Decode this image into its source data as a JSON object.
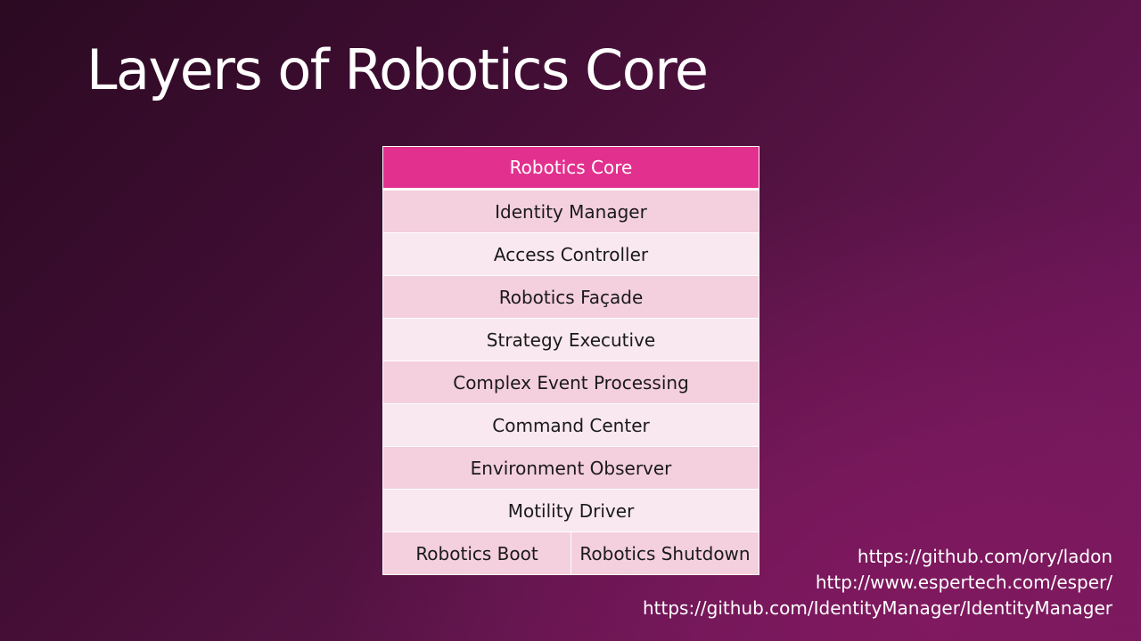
{
  "slide": {
    "title": "Layers of Robotics Core"
  },
  "table": {
    "header": "Robotics Core",
    "layers": [
      "Identity Manager",
      "Access Controller",
      "Robotics Façade",
      "Strategy Executive",
      "Complex Event Processing",
      "Command Center",
      "Environment Observer",
      "Motility Driver"
    ],
    "bottom_row": [
      "Robotics Boot",
      "Robotics Shutdown"
    ]
  },
  "links": [
    "https://github.com/ory/ladon",
    "http://www.espertech.com/esper/",
    "https://github.com/IdentityManager/IdentityManager"
  ],
  "colors": {
    "header_fill": "#e2308e",
    "row_dark": "#f4cfdd",
    "row_light": "#f9e8ef",
    "background": "#5a1446"
  }
}
